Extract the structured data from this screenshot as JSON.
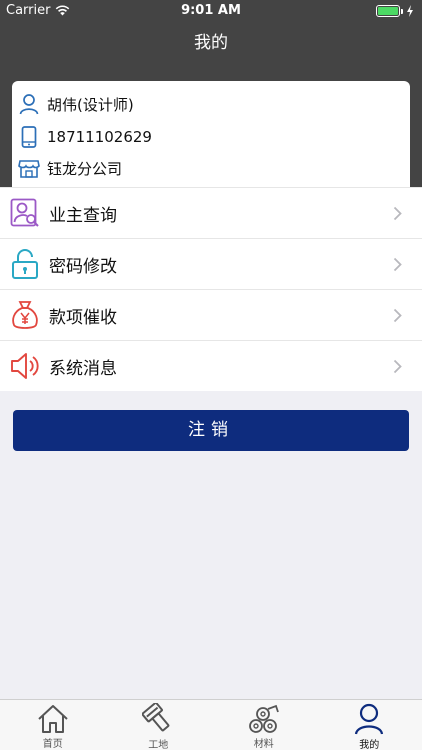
{
  "status_bar": {
    "carrier": "Carrier",
    "time": "9:01 AM"
  },
  "nav": {
    "title": "我的"
  },
  "profile": {
    "name": "胡伟(设计师)",
    "phone": "18711102629",
    "company": "钰龙分公司"
  },
  "menu": {
    "items": [
      {
        "label": "业主查询",
        "icon": "owner-search-icon",
        "color": "#9b59c6"
      },
      {
        "label": "密码修改",
        "icon": "lock-icon",
        "color": "#2aa8c4"
      },
      {
        "label": "款项催收",
        "icon": "money-bag-icon",
        "color": "#e2473f"
      },
      {
        "label": "系统消息",
        "icon": "speaker-icon",
        "color": "#e2473f"
      }
    ]
  },
  "logout": {
    "label": "注销"
  },
  "tabs": [
    {
      "label": "首页",
      "icon": "home-icon"
    },
    {
      "label": "工地",
      "icon": "construction-icon"
    },
    {
      "label": "材料",
      "icon": "materials-icon"
    },
    {
      "label": "我的",
      "icon": "profile-icon",
      "active": true
    }
  ],
  "colors": {
    "header": "#444444",
    "primary": "#0e2c7e",
    "background": "#efeff4"
  }
}
